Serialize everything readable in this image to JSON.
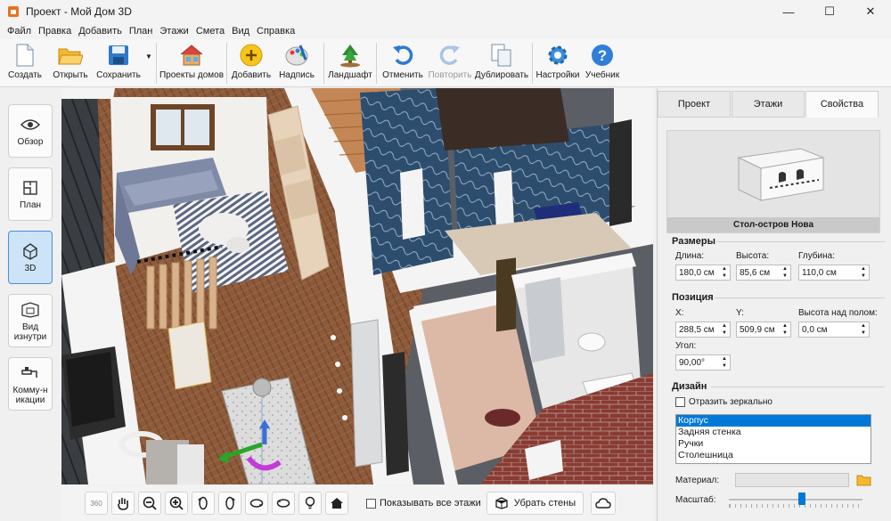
{
  "window": {
    "title": "Проект - Мой Дом 3D",
    "minimize_glyph": "—",
    "maximize_glyph": "☐",
    "close_glyph": "✕"
  },
  "menu": [
    "Файл",
    "Правка",
    "Добавить",
    "План",
    "Этажи",
    "Смета",
    "Вид",
    "Справка"
  ],
  "toolbar": {
    "create": "Создать",
    "open": "Открыть",
    "save": "Сохранить",
    "house_projects": "Проекты домов",
    "add": "Добавить",
    "label": "Надпись",
    "landscape": "Ландшафт",
    "undo": "Отменить",
    "redo": "Повторить",
    "duplicate": "Дублировать",
    "settings": "Настройки",
    "tutorial": "Учебник",
    "dropdown_glyph": "▼"
  },
  "left_nav": {
    "overview": "Обзор",
    "plan": "План",
    "view3d": "3D",
    "inside": "Вид изнутри",
    "utilities": "Комму-никации"
  },
  "viewbar": {
    "rotate360": "360",
    "show_all_floors": "Показывать все этажи",
    "remove_walls": "Убрать стены"
  },
  "right_panel": {
    "tabs": [
      "Проект",
      "Этажи",
      "Свойства"
    ],
    "active_tab": "Свойства",
    "object_name": "Стол-остров Нова",
    "dimensions": {
      "title": "Размеры",
      "length_label": "Длина:",
      "length": "180,0 см",
      "height_label": "Высота:",
      "height": "85,6 см",
      "depth_label": "Глубина:",
      "depth": "110,0 см"
    },
    "position": {
      "title": "Позиция",
      "x_label": "X:",
      "x": "288,5 см",
      "y_label": "Y:",
      "y": "509,9 см",
      "elev_label": "Высота над полом:",
      "elev": "0,0 см",
      "angle_label": "Угол:",
      "angle": "90,00°"
    },
    "design": {
      "title": "Дизайн",
      "mirror_label": "Отразить зеркально",
      "parts": [
        "Корпус",
        "Задняя стенка",
        "Ручки",
        "Столешница"
      ],
      "selected_part": "Корпус",
      "material_label": "Материал:",
      "scale_label": "Масштаб:",
      "scale_value": 0.55
    }
  },
  "colors": {
    "accent": "#0078d7",
    "active_nav": "#cde3f7",
    "floor_wood": "#8b5a3c",
    "brick": "#8a3b32",
    "wall_top": "#f4f4f4",
    "tile_blue": "#2e4a6b"
  }
}
